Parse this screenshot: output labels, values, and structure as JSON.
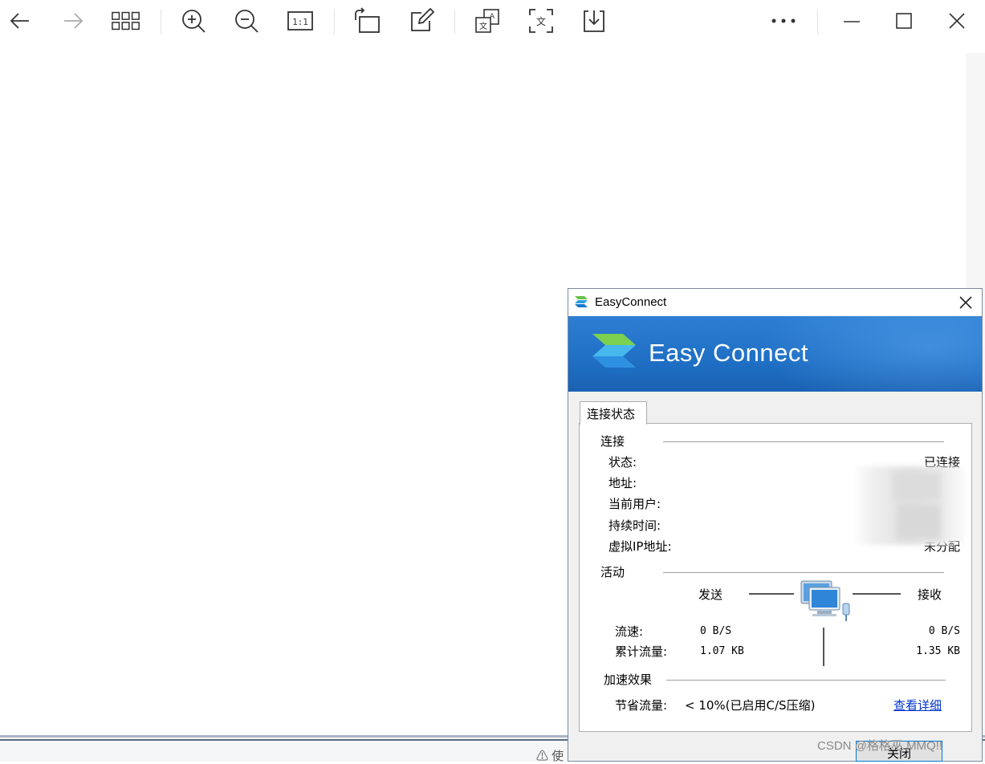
{
  "viewer": {
    "toolbar_icons": [
      "back-arrow-icon",
      "forward-arrow-icon",
      "grid-view-icon",
      "zoom-in-icon",
      "zoom-out-icon",
      "actual-size-icon",
      "rotate-icon",
      "edit-icon",
      "translate-icon",
      "text-extract-icon",
      "download-icon",
      "more-icon",
      "minimize-icon",
      "maximize-icon",
      "close-icon"
    ],
    "actual_size_label": "1:1",
    "bottom_fragment": "⚠ 使"
  },
  "watermark": "CSDN @格格巫 MMQ!!",
  "dialog": {
    "title": "EasyConnect",
    "banner_text": "Easy Connect",
    "tab_label": "连接状态",
    "connection": {
      "heading": "连接",
      "fields": [
        {
          "label": "状态:",
          "value": "已连接"
        },
        {
          "label": "地址:",
          "value": ""
        },
        {
          "label": "当前用户:",
          "value": ""
        },
        {
          "label": "持续时间:",
          "value": ""
        },
        {
          "label": "虚拟IP地址:",
          "value": "未分配"
        }
      ]
    },
    "activity": {
      "heading": "活动",
      "send_label": "发送",
      "recv_label": "接收",
      "speed_label": "流速:",
      "send_speed": "0 B/S",
      "recv_speed": "0 B/S",
      "total_label": "累计流量:",
      "sent_total": "1.07 KB",
      "recv_total": "1.35 KB"
    },
    "acceleration": {
      "heading": "加速效果",
      "saving_label": "节省流量:",
      "saving_value": "< 10%(已启用C/S压缩)",
      "detail_link": "查看详细"
    },
    "close_button": "关闭"
  }
}
